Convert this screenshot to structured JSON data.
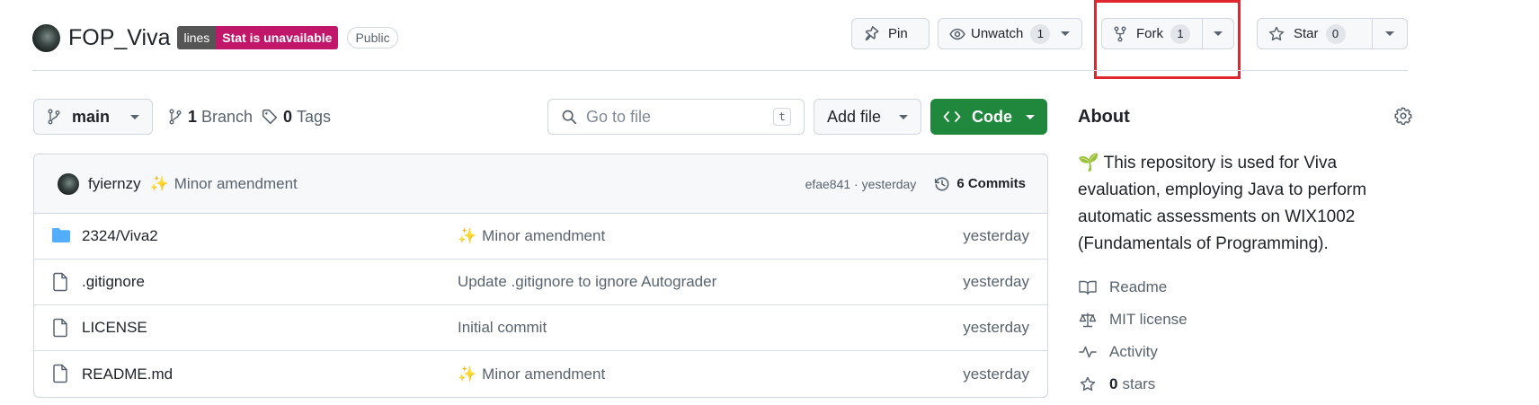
{
  "repo": {
    "name": "FOP_Viva",
    "badge_left": "lines",
    "badge_right": "Stat is unavailable",
    "visibility": "Public"
  },
  "header_actions": {
    "pin": "Pin",
    "unwatch": "Unwatch",
    "unwatch_count": "1",
    "fork": "Fork",
    "fork_count": "1",
    "star": "Star",
    "star_count": "0"
  },
  "toolbar": {
    "branch": "main",
    "branches_count": "1",
    "branches_label": "Branch",
    "tags_count": "0",
    "tags_label": "Tags",
    "search_placeholder": "Go to file",
    "search_shortcut": "t",
    "add_file": "Add file",
    "code": "Code"
  },
  "latest_commit": {
    "author": "fyiernzy",
    "emoji": "✨",
    "message": "Minor amendment",
    "meta": "efae841 · yesterday",
    "commits": "6 Commits"
  },
  "files": [
    {
      "name": "2324/Viva2",
      "type": "folder",
      "emoji": "✨",
      "message": "Minor amendment",
      "date": "yesterday"
    },
    {
      "name": ".gitignore",
      "type": "file",
      "emoji": "",
      "message": "Update .gitignore to ignore Autograder",
      "date": "yesterday"
    },
    {
      "name": "LICENSE",
      "type": "file",
      "emoji": "",
      "message": "Initial commit",
      "date": "yesterday"
    },
    {
      "name": "README.md",
      "type": "file",
      "emoji": "✨",
      "message": "Minor amendment",
      "date": "yesterday"
    }
  ],
  "about": {
    "title": "About",
    "description_emoji": "🌱",
    "description": "This repository is used for Viva evaluation, employing Java to perform automatic assessments on WIX1002 (Fundamentals of Programming).",
    "readme": "Readme",
    "license": "MIT license",
    "activity": "Activity",
    "stars_count": "0",
    "stars_label": "stars"
  },
  "colors": {
    "accent_green": "#1f883d",
    "highlight_red": "#e0262e",
    "badge_magenta": "#c0176b",
    "folder_blue": "#54aeff"
  }
}
